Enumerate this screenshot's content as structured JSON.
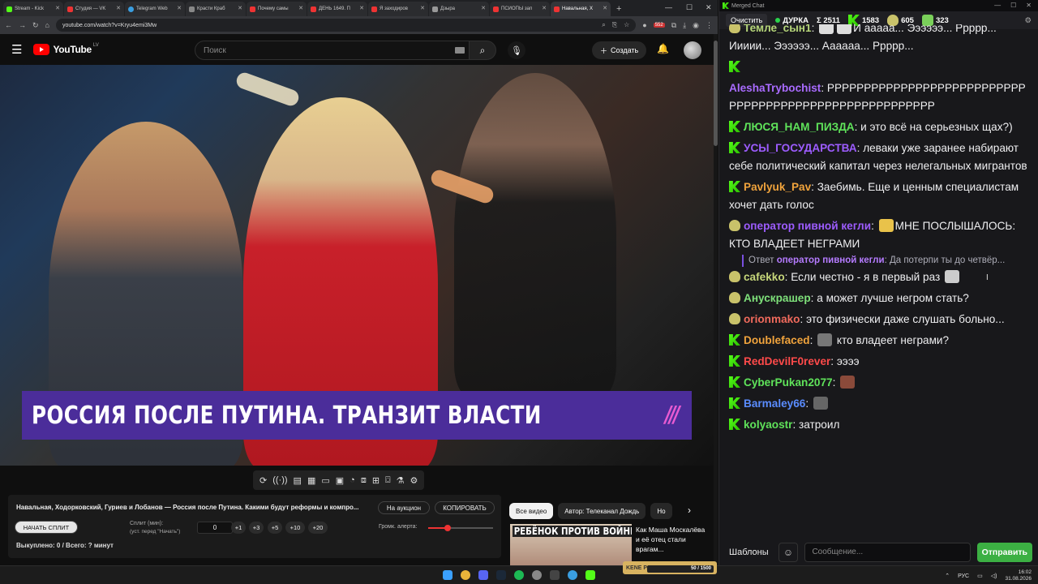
{
  "browser": {
    "tabs": [
      "Stream - Kick",
      "Студия — VK",
      "Telegram Web",
      "Красти Краб",
      "Почему самы",
      "ДЕНЬ 1649. П",
      "Я заходиров",
      "Дзыра",
      "ПСИОПЫ зап",
      "Навальная, Х"
    ],
    "url": "youtube.com/watch?v=Kryu4emi3Mw",
    "new_tab": "+",
    "badge_count": "552"
  },
  "youtube": {
    "logo": "YouTube",
    "region": "LV",
    "search_placeholder": "Поиск",
    "create_label": "Создать"
  },
  "video": {
    "banner_text": "РОССИЯ ПОСЛЕ ПУТИНА. ТРАНЗИТ ВЛАСТИ",
    "banner_mark": "///"
  },
  "panel": {
    "title": "Навальная, Ходорковский, Гуриев и Лобанов — Россия после Путина. Какими будут реформы и компро...",
    "auction_label": "На аукцион",
    "copy_label": "КОПИРОВАТЬ",
    "split_button": "НАЧАТЬ СПЛИТ",
    "split_label": "Сплит (мин):",
    "split_hint": "(уст. перед \"Начать\")",
    "split_value": "0",
    "increments": [
      "+1",
      "+3",
      "+5",
      "+10",
      "+20"
    ],
    "status": "Выкуплено: 0 / Всего: ? минут",
    "alert_label": "Громк. алерта:",
    "alert_volume": 0.3
  },
  "recommendations": {
    "chips": [
      "Все видео",
      "Автор: Телеканал Дождь",
      "Но"
    ],
    "thumb_text": "РЕБЁНОК ПРОТИВ ВОЙНЫ",
    "title": "Как Маша Москалёва и её отец стали врагам..."
  },
  "chat": {
    "window_title": "Merged Chat",
    "clear_label": "Очистить",
    "channel": "ДУРКА",
    "stats": [
      "Σ 2511",
      "1583",
      "605",
      "323"
    ],
    "messages": [
      {
        "badge": "frog",
        "user": "Темле_сын1",
        "color": "#b6d67a",
        "text": "И ааааа... Ээээээ... Ррррр... Иииии... Ээээээ... Аааааа... Ррррр..."
      },
      {
        "badge": "kick",
        "user": "",
        "color": "#53fc18",
        "text": ""
      },
      {
        "badge": "none",
        "user": "AleshaTrybochist",
        "color": "#a96bff",
        "text": "РРРРРРРРРРРРРРРРРРРРРРРРРРРРРРРРРРРРРРРРРРРРРРРРРРРРРРР"
      },
      {
        "badge": "kick",
        "user": "ЛЮСЯ_НАМ_ПИЗДА",
        "color": "#5fe35a",
        "text": "и это всё на серьезных щах?)"
      },
      {
        "badge": "kick",
        "user": "УСЫ_ГОСУДАРСТВА",
        "color": "#9d5cff",
        "text": "леваки уже заранее набирают себе политический капитал через нелегальных мигрантов"
      },
      {
        "badge": "kick",
        "user": "Pavlyuk_Pav",
        "color": "#f0a33c",
        "text": "Заебимь. Еще и ценным специалистам хочет дать голос"
      },
      {
        "badge": "frog",
        "user": "оператор пивной кегли",
        "color": "#9d5cff",
        "text": "МНЕ ПОСЛЫШАЛОСЬ: КТО ВЛАДЕЕТ НЕГРАМИ"
      },
      {
        "badge": "reply",
        "user": "оператор пивной кегли",
        "color": "#b57bff",
        "text": "Да потерпи ты до четвёр...",
        "prefix": "Ответ"
      },
      {
        "badge": "frog",
        "user": "cafekko",
        "color": "#c6d67a",
        "text": "Если честно - я в первый раз"
      },
      {
        "badge": "frog",
        "user": "Анускрашер",
        "color": "#7ee07a",
        "text": "а может лучше негром стать?"
      },
      {
        "badge": "frog",
        "user": "orionmako",
        "color": "#f06a5c",
        "text": "это физически даже слушать больно..."
      },
      {
        "badge": "kick",
        "user": "Doublefaced",
        "color": "#f0a33c",
        "text": "кто владеет неграми?"
      },
      {
        "badge": "kick",
        "user": "RedDevilF0rever",
        "color": "#ff4a4a",
        "text": "ээээ"
      },
      {
        "badge": "kick",
        "user": "CyberPukan2077",
        "color": "#5fe35a",
        "text": ""
      },
      {
        "badge": "kick",
        "user": "Barmaley66",
        "color": "#5a8cff",
        "text": ""
      },
      {
        "badge": "kick",
        "user": "kolyaostr",
        "color": "#5fe35a",
        "text": "затроил"
      }
    ],
    "templates_label": "Шаблоны",
    "input_placeholder": "Сообщение...",
    "send_label": "Отправить"
  },
  "taskbar": {
    "lang": "РУС",
    "time": "16:02",
    "date": "31.08.2026",
    "pip_label": "KENE PARTY",
    "pip_progress": "50 / 1500"
  }
}
